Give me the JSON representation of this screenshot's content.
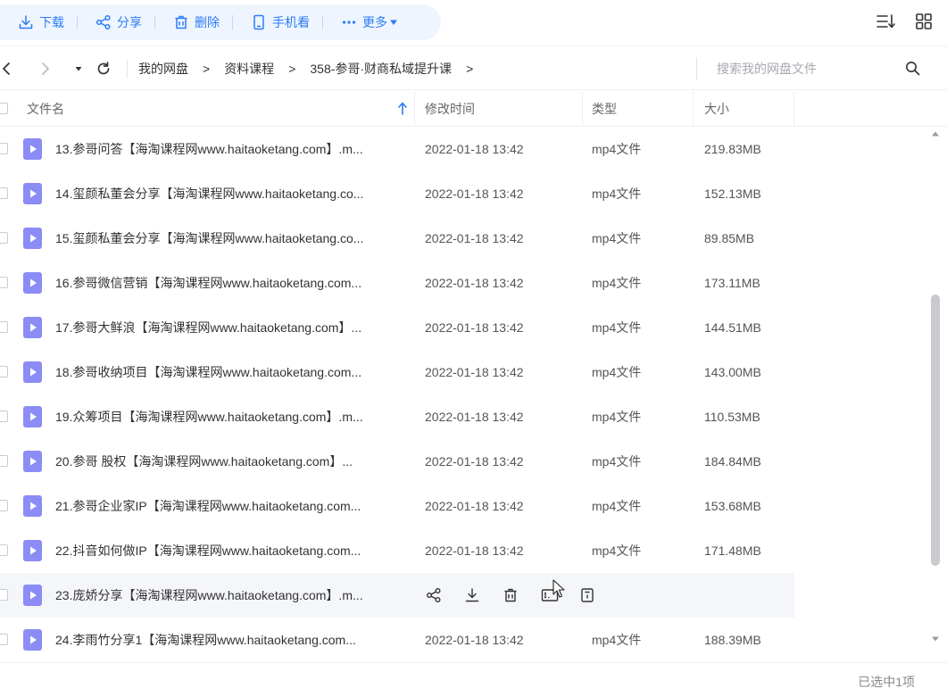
{
  "toolbar": {
    "download": "下载",
    "share": "分享",
    "delete": "删除",
    "phone_view": "手机看",
    "more": "更多",
    "accent_color": "#2b7cf6"
  },
  "nav": {
    "breadcrumbs": [
      "我的网盘",
      "资料课程",
      "358-参哥·财商私域提升课"
    ],
    "search_placeholder": "搜索我的网盘文件"
  },
  "table": {
    "columns": {
      "name": "文件名",
      "modified": "修改时间",
      "type": "类型",
      "size": "大小"
    },
    "rows": [
      {
        "name": "13.参哥问答【海淘课程网www.haitaoketang.com】.m...",
        "modified": "2022-01-18 13:42",
        "type": "mp4文件",
        "size": "219.83MB"
      },
      {
        "name": "14.玺颜私董会分享【海淘课程网www.haitaoketang.co...",
        "modified": "2022-01-18 13:42",
        "type": "mp4文件",
        "size": "152.13MB"
      },
      {
        "name": "15.玺颜私董会分享【海淘课程网www.haitaoketang.co...",
        "modified": "2022-01-18 13:42",
        "type": "mp4文件",
        "size": "89.85MB"
      },
      {
        "name": "16.参哥微信营销【海淘课程网www.haitaoketang.com...",
        "modified": "2022-01-18 13:42",
        "type": "mp4文件",
        "size": "173.11MB"
      },
      {
        "name": "17.参哥大鲜浪【海淘课程网www.haitaoketang.com】...",
        "modified": "2022-01-18 13:42",
        "type": "mp4文件",
        "size": "144.51MB"
      },
      {
        "name": "18.参哥收纳项目【海淘课程网www.haitaoketang.com...",
        "modified": "2022-01-18 13:42",
        "type": "mp4文件",
        "size": "143.00MB"
      },
      {
        "name": "19.众筹项目【海淘课程网www.haitaoketang.com】.m...",
        "modified": "2022-01-18 13:42",
        "type": "mp4文件",
        "size": "110.53MB"
      },
      {
        "name": "20.参哥 股权【海淘课程网www.haitaoketang.com】...",
        "modified": "2022-01-18 13:42",
        "type": "mp4文件",
        "size": "184.84MB"
      },
      {
        "name": "21.参哥企业家IP【海淘课程网www.haitaoketang.com...",
        "modified": "2022-01-18 13:42",
        "type": "mp4文件",
        "size": "153.68MB"
      },
      {
        "name": "22.抖音如何做IP【海淘课程网www.haitaoketang.com...",
        "modified": "2022-01-18 13:42",
        "type": "mp4文件",
        "size": "171.48MB"
      },
      {
        "name": "23.庞娇分享【海淘课程网www.haitaoketang.com】.m...",
        "modified": "",
        "type": "",
        "size": ""
      },
      {
        "name": "24.李雨竹分享1【海淘课程网www.haitaoketang.com...",
        "modified": "2022-01-18 13:42",
        "type": "mp4文件",
        "size": "188.39MB"
      }
    ],
    "hovered_row_index": 10
  },
  "status": {
    "selected_text": "已选中1项"
  },
  "icons": {
    "file_icon_color": "#8b8cf5"
  }
}
